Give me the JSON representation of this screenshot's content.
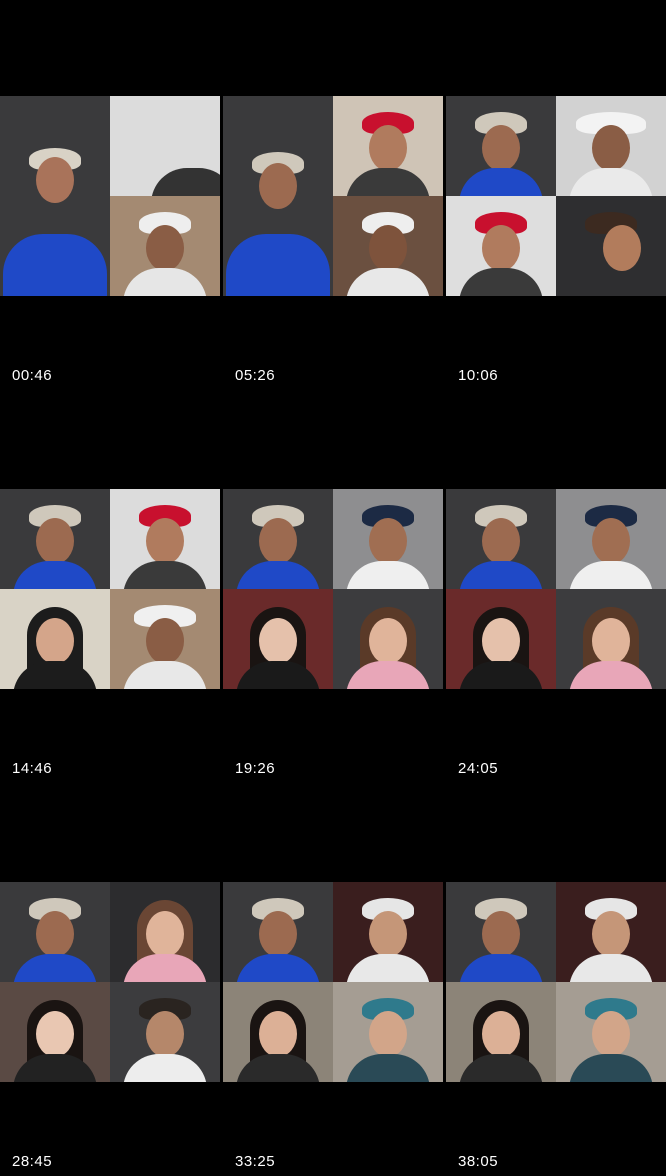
{
  "grid": {
    "thumbnails": [
      {
        "time": "00:46"
      },
      {
        "time": "05:26"
      },
      {
        "time": "10:06"
      },
      {
        "time": "14:46"
      },
      {
        "time": "19:26"
      },
      {
        "time": "24:05"
      },
      {
        "time": "28:45"
      },
      {
        "time": "33:25"
      },
      {
        "time": "38:05"
      }
    ]
  },
  "colors": {
    "background": "#000000",
    "jacket_blue": "#1f49c7",
    "cap_red": "#c8102e",
    "studio_gray": "#5e5e60",
    "room_beige": "#b8a48c",
    "pink_top": "#e8a6b8"
  }
}
